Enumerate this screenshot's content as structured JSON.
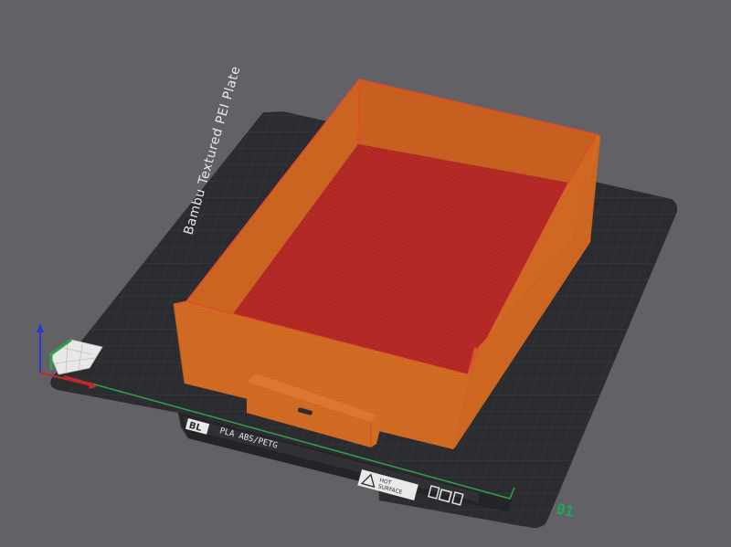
{
  "plate": {
    "name_label": "Bambu Textured PEI Plate",
    "material_label": "PLA ABS/PETG",
    "logo_text": "BL",
    "hot_surface": [
      "HOT",
      "SURFACE"
    ],
    "plate_number": "01"
  },
  "icons": [
    "axis-gizmo-icon",
    "hot-surface-warning-icon",
    "plate-settings-icons"
  ],
  "colors": {
    "background": "#626266",
    "bed": "#2b2c2f",
    "grid": "#3c3d41",
    "model_wall": "#d26b24",
    "model_floor": "#b52a26",
    "model_edge": "#e04a2b",
    "x_axis": "#c02a2a",
    "y_axis": "#2fa14e",
    "z_axis": "#2a39c8",
    "plate_number": "#1fa84e"
  }
}
